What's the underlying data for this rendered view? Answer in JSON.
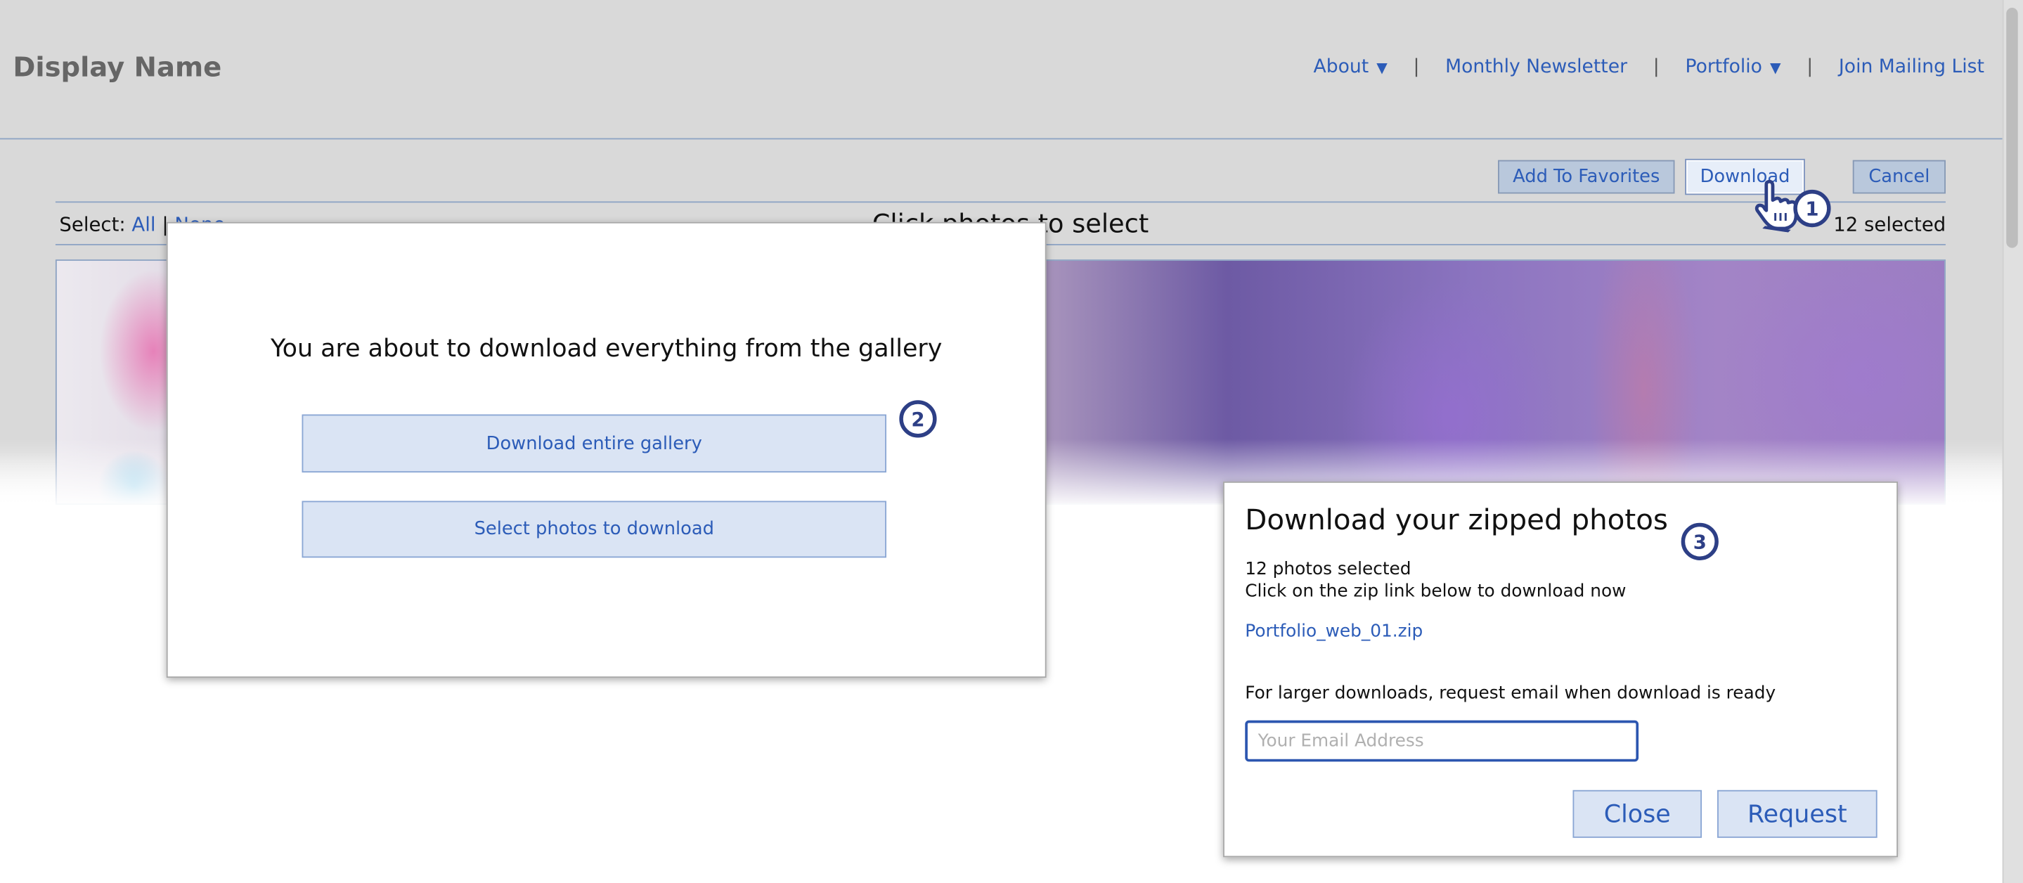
{
  "header": {
    "site_title": "Display Name",
    "nav": [
      {
        "label": "About",
        "caret": "▼"
      },
      {
        "label": "Monthly Newsletter"
      },
      {
        "label": "Portfolio",
        "caret": "▼"
      },
      {
        "label": "Join Mailing List"
      }
    ],
    "separator": "|"
  },
  "toolbar": {
    "add_favorites": "Add To Favorites",
    "download": "Download",
    "cancel": "Cancel"
  },
  "selection_bar": {
    "label": "Select:",
    "all": "All",
    "divider": "|",
    "none": "None",
    "hint": "Click photos to select",
    "count": "12 selected"
  },
  "gallery_modal": {
    "title": "You are about to download everything from the gallery",
    "download_entire": "Download entire gallery",
    "select_photos": "Select photos to download"
  },
  "zip_modal": {
    "title": "Download your zipped photos",
    "photos_selected": "12 photos selected",
    "instructions": "Click on the zip link below to download now",
    "zip_file": "Portfolio_web_01.zip",
    "larger_note": "For larger downloads, request email when download is ready",
    "email_placeholder": "Your Email Address",
    "close": "Close",
    "request": "Request"
  },
  "badges": [
    "1",
    "2",
    "3"
  ],
  "icons": {
    "cursor": "hand-pointer-icon"
  },
  "colors": {
    "accent": "#2c5cb8",
    "badge": "#2d3f86",
    "button_fill": "#dae4f4"
  }
}
